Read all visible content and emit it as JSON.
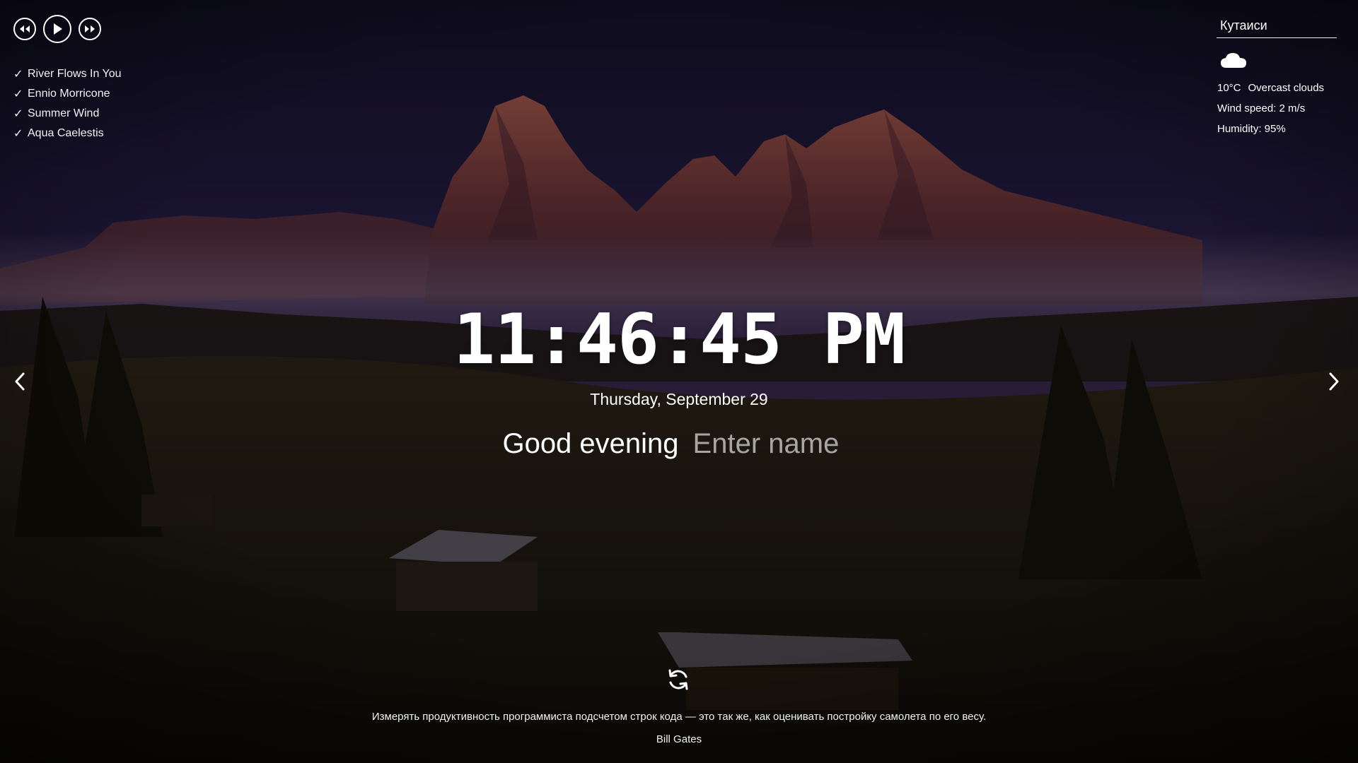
{
  "player": {
    "playlist": [
      {
        "title": "River Flows In You"
      },
      {
        "title": "Ennio Morricone"
      },
      {
        "title": "Summer Wind"
      },
      {
        "title": "Aqua Caelestis"
      }
    ],
    "check_glyph": "✓"
  },
  "weather": {
    "city": "Кутаиси",
    "icon": "overcast-clouds-icon",
    "temperature": "10°C",
    "description": "Overcast clouds",
    "wind": "Wind speed: 2 m/s",
    "humidity": "Humidity: 95%"
  },
  "clock": {
    "time": "11:46:45 PM",
    "date": "Thursday, September 29"
  },
  "greeting": {
    "text": "Good evening",
    "name_placeholder": "Enter name",
    "name_value": ""
  },
  "quote": {
    "text": "Измерять продуктивность программиста подсчетом строк кода — это так же, как оценивать постройку самолета по его весу.",
    "author": "Bill Gates"
  },
  "colors": {
    "sky_top": "#1b1635",
    "sky_mid": "#2e2350",
    "mountain": "#6b3438",
    "mountain_light": "#9a4f45",
    "mist": "#6d5a72",
    "ground": "#1c170f",
    "text": "#ffffff"
  }
}
